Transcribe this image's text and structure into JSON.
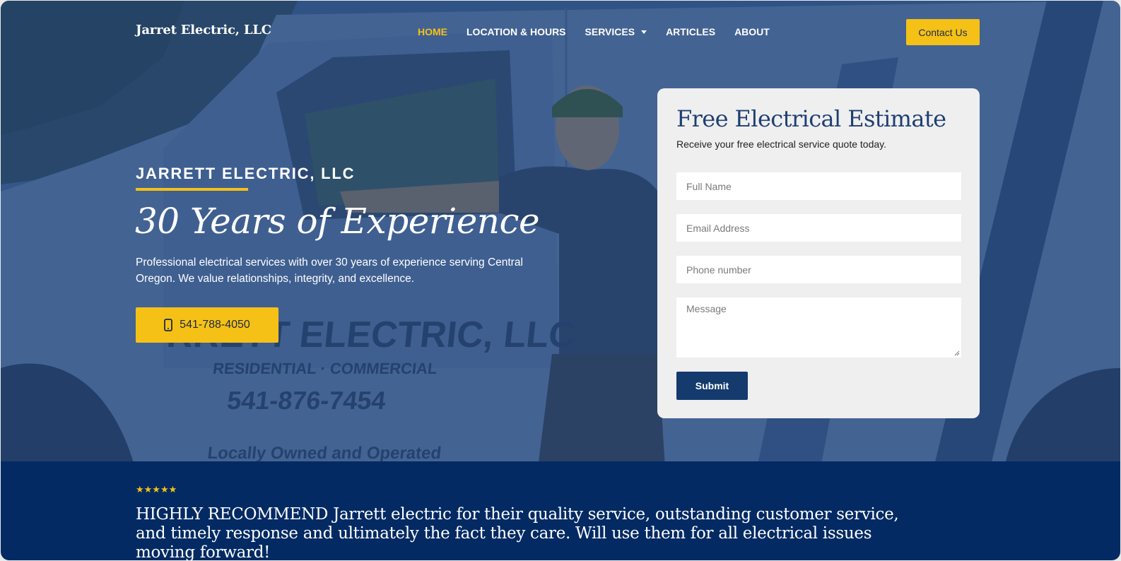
{
  "nav": {
    "logo": "Jarret Electric, LLC",
    "items": [
      {
        "label": "HOME",
        "active": true
      },
      {
        "label": "LOCATION & HOURS",
        "active": false
      },
      {
        "label": "SERVICES",
        "active": false,
        "has_dropdown": true
      },
      {
        "label": "ARTICLES",
        "active": false
      },
      {
        "label": "ABOUT",
        "active": false
      }
    ],
    "contact_label": "Contact Us"
  },
  "hero": {
    "eyebrow": "JARRETT ELECTRIC, LLC",
    "headline": "30 Years of Experience",
    "description": "Professional electrical services with over 30 years of experience serving Central Oregon. We value relationships, integrity, and excellence.",
    "phone_button": "541-788-4050",
    "phone_icon": "mobile-phone-icon",
    "background_image_text": {
      "truck_name": "RRETT ELECTRIC, LLC",
      "truck_tagline": "RESIDENTIAL · COMMERCIAL",
      "truck_phone": "541-876-7454",
      "truck_footer": "Locally Owned and Operated"
    }
  },
  "form": {
    "title": "Free Electrical Estimate",
    "subtitle": "Receive your free electrical service quote today.",
    "fields": {
      "full_name": "Full Name",
      "email": "Email Address",
      "phone": "Phone number",
      "message": "Message"
    },
    "submit_label": "Submit"
  },
  "testimonial": {
    "stars": "★★★★★",
    "rating": 5,
    "quote": "HIGHLY RECOMMEND Jarrett electric for their quality service, outstanding customer service, and timely response and ultimately the fact they care. Will use them for all electrical issues moving forward!"
  },
  "colors": {
    "accent": "#f5c116",
    "navy": "#032a63",
    "button_navy": "#143a6e",
    "card_bg": "#efefef"
  }
}
